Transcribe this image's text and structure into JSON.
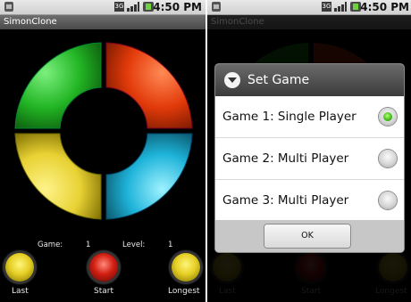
{
  "status_bar": {
    "time": "4:50 PM",
    "network_badge": "3G"
  },
  "app": {
    "title": "SimonClone"
  },
  "colors": {
    "green": "#22b524",
    "red": "#e23a0a",
    "yellow": "#e8d234",
    "blue": "#1eb3d9"
  },
  "game_info": {
    "game_label": "Game:",
    "game_value": "1",
    "level_label": "Level:",
    "level_value": "1"
  },
  "controls": {
    "last_label": "Last",
    "start_label": "Start",
    "longest_label": "Longest"
  },
  "dialog": {
    "title": "Set Game",
    "options": [
      {
        "label": "Game 1: Single Player",
        "selected": true
      },
      {
        "label": "Game 2: Multi Player",
        "selected": false
      },
      {
        "label": "Game 3: Multi Player",
        "selected": false
      }
    ],
    "ok_label": "OK"
  }
}
